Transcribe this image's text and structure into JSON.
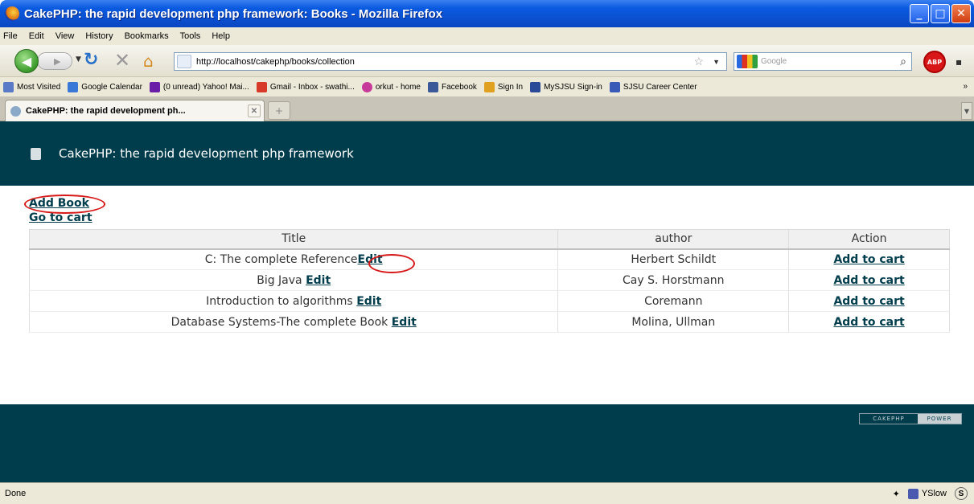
{
  "window": {
    "title": "CakePHP: the rapid development php framework: Books - Mozilla Firefox"
  },
  "menu": [
    "File",
    "Edit",
    "View",
    "History",
    "Bookmarks",
    "Tools",
    "Help"
  ],
  "nav": {
    "url": "http://localhost/cakephp/books/collection",
    "search_placeholder": "Google"
  },
  "bookmarks": [
    {
      "label": "Most Visited",
      "icon": "most-visited-icon",
      "color": "#5a7ac8"
    },
    {
      "label": "Google Calendar",
      "icon": "calendar-icon",
      "color": "#3a78d8"
    },
    {
      "label": "(0 unread) Yahoo! Mai...",
      "icon": "yahoo-icon",
      "color": "#6a1ea8"
    },
    {
      "label": "Gmail - Inbox - swathi...",
      "icon": "gmail-icon",
      "color": "#d83a2a"
    },
    {
      "label": "orkut - home",
      "icon": "orkut-icon",
      "color": "#c83a9a"
    },
    {
      "label": "Facebook",
      "icon": "facebook-icon",
      "color": "#3b5998"
    },
    {
      "label": "Sign In",
      "icon": "signin-icon",
      "color": "#e0a020"
    },
    {
      "label": "MySJSU Sign-in",
      "icon": "mysjsu-icon",
      "color": "#2a4a98"
    },
    {
      "label": "SJSU Career Center",
      "icon": "sjsu-icon",
      "color": "#3a5ab8"
    }
  ],
  "tab": {
    "label": "CakePHP: the rapid development ph..."
  },
  "page": {
    "header": "CakePHP: the rapid development php framework",
    "add_book": "Add Book",
    "go_to_cart": "Go to cart",
    "edit_label": "Edit",
    "columns": [
      "Title",
      "author",
      "Action"
    ],
    "rows": [
      {
        "title": "C: The complete Reference",
        "author": "Herbert Schildt",
        "action": "Add to cart"
      },
      {
        "title": "Big Java",
        "author": "Cay S. Horstmann",
        "action": "Add to cart"
      },
      {
        "title": "Introduction to algorithms",
        "author": "Coremann",
        "action": "Add to cart"
      },
      {
        "title": "Database Systems-The complete Book",
        "author": "Molina, Ullman",
        "action": "Add to cart"
      }
    ],
    "powered": [
      "CAKEPHP",
      "POWER"
    ]
  },
  "status": {
    "text": "Done",
    "yslow": "YSlow"
  },
  "colors": {
    "header_bg": "#003d4c",
    "annotation": "#d81818"
  }
}
